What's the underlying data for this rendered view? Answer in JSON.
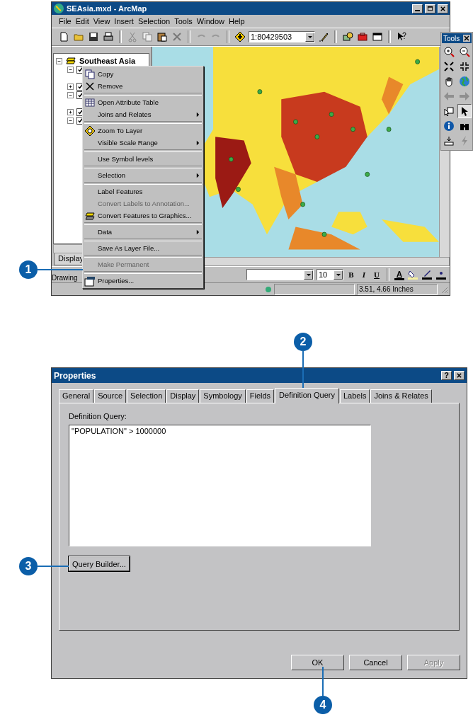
{
  "arcmap": {
    "title": "SEAsia.mxd - ArcMap",
    "menus": [
      "File",
      "Edit",
      "View",
      "Insert",
      "Selection",
      "Tools",
      "Window",
      "Help"
    ],
    "scale": "1:80429503",
    "toc": {
      "root": {
        "label": "Southeast Asia",
        "expanded": true,
        "children": [
          {
            "expanded": true,
            "checked": true
          },
          {
            "expanded": false,
            "checked": true
          },
          {
            "expanded": true,
            "checked": true
          },
          {
            "expanded": false,
            "checked": true
          },
          {
            "expanded": true,
            "checked": true
          }
        ]
      },
      "tabs": [
        {
          "label": "Display",
          "selected": true
        }
      ]
    },
    "drawing_toolbar": {
      "label": "Drawing",
      "font_size": "10",
      "format_buttons": [
        "B",
        "I",
        "U"
      ],
      "font_color": "A"
    },
    "status": "3.51, 4.66 Inches"
  },
  "context_menu": [
    {
      "kind": "item",
      "label": "Copy",
      "disabled": false,
      "submenu": false
    },
    {
      "kind": "item",
      "label": "Remove",
      "disabled": false,
      "submenu": false
    },
    {
      "kind": "separator"
    },
    {
      "kind": "item",
      "label": "Open Attribute Table",
      "disabled": false,
      "submenu": false
    },
    {
      "kind": "item",
      "label": "Joins and Relates",
      "disabled": false,
      "submenu": true
    },
    {
      "kind": "separator"
    },
    {
      "kind": "item",
      "label": "Zoom To Layer",
      "disabled": false,
      "submenu": false
    },
    {
      "kind": "item",
      "label": "Visible Scale Range",
      "disabled": false,
      "submenu": true
    },
    {
      "kind": "separator"
    },
    {
      "kind": "item",
      "label": "Use Symbol levels",
      "disabled": false,
      "submenu": false
    },
    {
      "kind": "separator"
    },
    {
      "kind": "item",
      "label": "Selection",
      "disabled": false,
      "submenu": true
    },
    {
      "kind": "separator"
    },
    {
      "kind": "item",
      "label": "Label Features",
      "disabled": false,
      "submenu": false
    },
    {
      "kind": "item",
      "label": "Convert Labels to Annotation...",
      "disabled": true,
      "submenu": false
    },
    {
      "kind": "item",
      "label": "Convert Features to Graphics...",
      "disabled": false,
      "submenu": false
    },
    {
      "kind": "separator"
    },
    {
      "kind": "item",
      "label": "Data",
      "disabled": false,
      "submenu": true
    },
    {
      "kind": "separator"
    },
    {
      "kind": "item",
      "label": "Save As Layer File...",
      "disabled": false,
      "submenu": false
    },
    {
      "kind": "separator"
    },
    {
      "kind": "item",
      "label": "Make Permanent",
      "disabled": true,
      "submenu": false
    },
    {
      "kind": "separator"
    },
    {
      "kind": "item",
      "label": "Properties...",
      "disabled": false,
      "submenu": false
    }
  ],
  "tools_palette": {
    "title": "Tools",
    "tools": [
      {
        "selected": false,
        "disabled": false
      },
      {
        "selected": false,
        "disabled": false
      },
      {
        "selected": false,
        "disabled": false
      },
      {
        "selected": false,
        "disabled": false
      },
      {
        "selected": false,
        "disabled": false
      },
      {
        "selected": false,
        "disabled": false
      },
      {
        "selected": false,
        "disabled": true
      },
      {
        "selected": false,
        "disabled": true
      },
      {
        "selected": false,
        "disabled": false
      },
      {
        "selected": true,
        "disabled": false
      },
      {
        "selected": false,
        "disabled": false
      },
      {
        "selected": false,
        "disabled": false
      },
      {
        "selected": false,
        "disabled": false
      },
      {
        "selected": false,
        "disabled": true
      }
    ]
  },
  "properties": {
    "title": "Properties",
    "help": "?",
    "tabs": [
      {
        "label": "General",
        "selected": false
      },
      {
        "label": "Source",
        "selected": false
      },
      {
        "label": "Selection",
        "selected": false
      },
      {
        "label": "Display",
        "selected": false
      },
      {
        "label": "Symbology",
        "selected": false
      },
      {
        "label": "Fields",
        "selected": false
      },
      {
        "label": "Definition Query",
        "selected": true
      },
      {
        "label": "Labels",
        "selected": false
      },
      {
        "label": "Joins & Relates",
        "selected": false
      }
    ],
    "query_label": "Definition Query:",
    "query": "\"POPULATION\" > 1000000",
    "query_builder": "Query Builder...",
    "buttons": [
      {
        "label": "OK",
        "disabled": false
      },
      {
        "label": "Cancel",
        "disabled": false
      },
      {
        "label": "Apply",
        "disabled": true
      }
    ]
  },
  "callouts": [
    "1",
    "2",
    "3",
    "4"
  ]
}
